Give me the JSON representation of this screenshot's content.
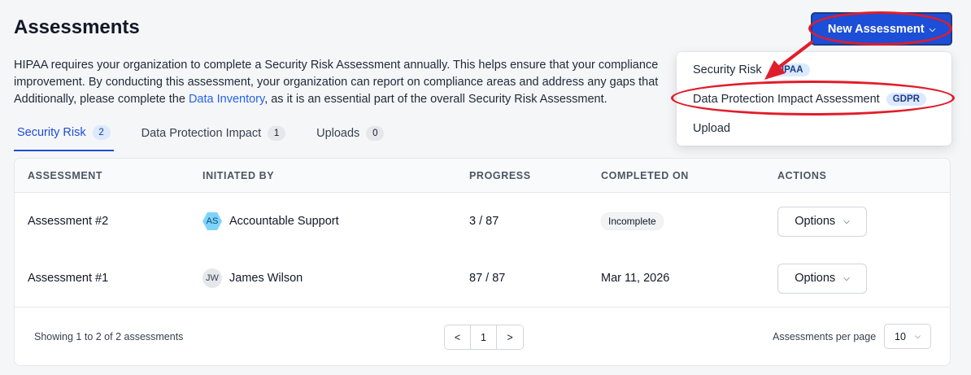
{
  "header": {
    "title": "Assessments",
    "new_button_label": "New Assessment"
  },
  "intro": {
    "line1": "HIPAA requires your organization to complete a Security Risk Assessment annually. This helps ensure that your compliance",
    "line2": "improvement. By conducting this assessment, your organization can report on compliance areas and address any gaps that",
    "line3_before": "Additionally, please complete the ",
    "link": "Data Inventory",
    "line3_after": ", as it is an essential part of the overall Security Risk Assessment."
  },
  "dropdown": {
    "items": [
      {
        "label": "Security Risk",
        "badge": "HIPAA"
      },
      {
        "label": "Data Protection Impact Assessment",
        "badge": "GDPR"
      },
      {
        "label": "Upload",
        "badge": ""
      }
    ]
  },
  "tabs": [
    {
      "label": "Security Risk",
      "count": "2",
      "active": true
    },
    {
      "label": "Data Protection Impact",
      "count": "1",
      "active": false
    },
    {
      "label": "Uploads",
      "count": "0",
      "active": false
    }
  ],
  "table": {
    "columns": [
      "ASSESSMENT",
      "INITIATED BY",
      "PROGRESS",
      "COMPLETED ON",
      "ACTIONS"
    ],
    "rows": [
      {
        "assessment": "Assessment #2",
        "initials": "AS",
        "initiated_by": "Accountable Support",
        "progress": "3 / 87",
        "completed_on": "Incomplete",
        "action": "Options"
      },
      {
        "assessment": "Assessment #1",
        "initials": "JW",
        "initiated_by": "James Wilson",
        "progress": "87 / 87",
        "completed_on": "Mar 11, 2026",
        "action": "Options"
      }
    ]
  },
  "footer": {
    "showing": "Showing 1 to 2 of 2 assessments",
    "prev": "<",
    "page": "1",
    "next": ">",
    "per_page_label": "Assessments per page",
    "per_page_value": "10"
  },
  "colors": {
    "primary": "#1d4ed8",
    "annotation": "#e11d2a"
  }
}
